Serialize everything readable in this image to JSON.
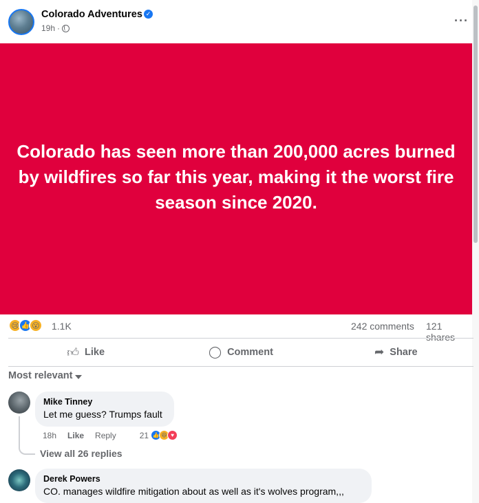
{
  "post": {
    "page_name": "Colorado Adventures",
    "verified_icon": "verified-check-icon",
    "time": "19h",
    "separator": "·",
    "audience_icon": "globe-icon",
    "more_icon": "more-options-icon",
    "more_label": "···",
    "image_text": "Colorado has seen more than 200,000 acres burned by wildfires so far this year, making it the worst fire season since 2020.",
    "image_bg": "#e0003d"
  },
  "stats": {
    "reaction_icons": [
      "sad-reaction-icon",
      "like-reaction-icon",
      "wow-reaction-icon"
    ],
    "reaction_count": "1.1K",
    "comments": "242 comments",
    "shares": "121 shares"
  },
  "actions": {
    "like": "Like",
    "comment": "Comment",
    "share": "Share"
  },
  "sort": {
    "label": "Most relevant"
  },
  "comments": [
    {
      "author": "Mike Tinney",
      "text": "Let me guess? Trumps fault",
      "time": "18h",
      "like": "Like",
      "reply": "Reply",
      "reaction_count": "21",
      "reaction_icons": [
        "like-reaction-icon",
        "haha-reaction-icon",
        "care-reaction-icon"
      ],
      "view_replies": "View all 26 replies"
    },
    {
      "author": "Derek Powers",
      "text": "CO. manages wildfire mitigation about as well as it's wolves program,,,"
    }
  ],
  "colors": {
    "accent": "#1877f2",
    "secondary_text": "#65676b",
    "bubble": "#f0f2f5"
  }
}
